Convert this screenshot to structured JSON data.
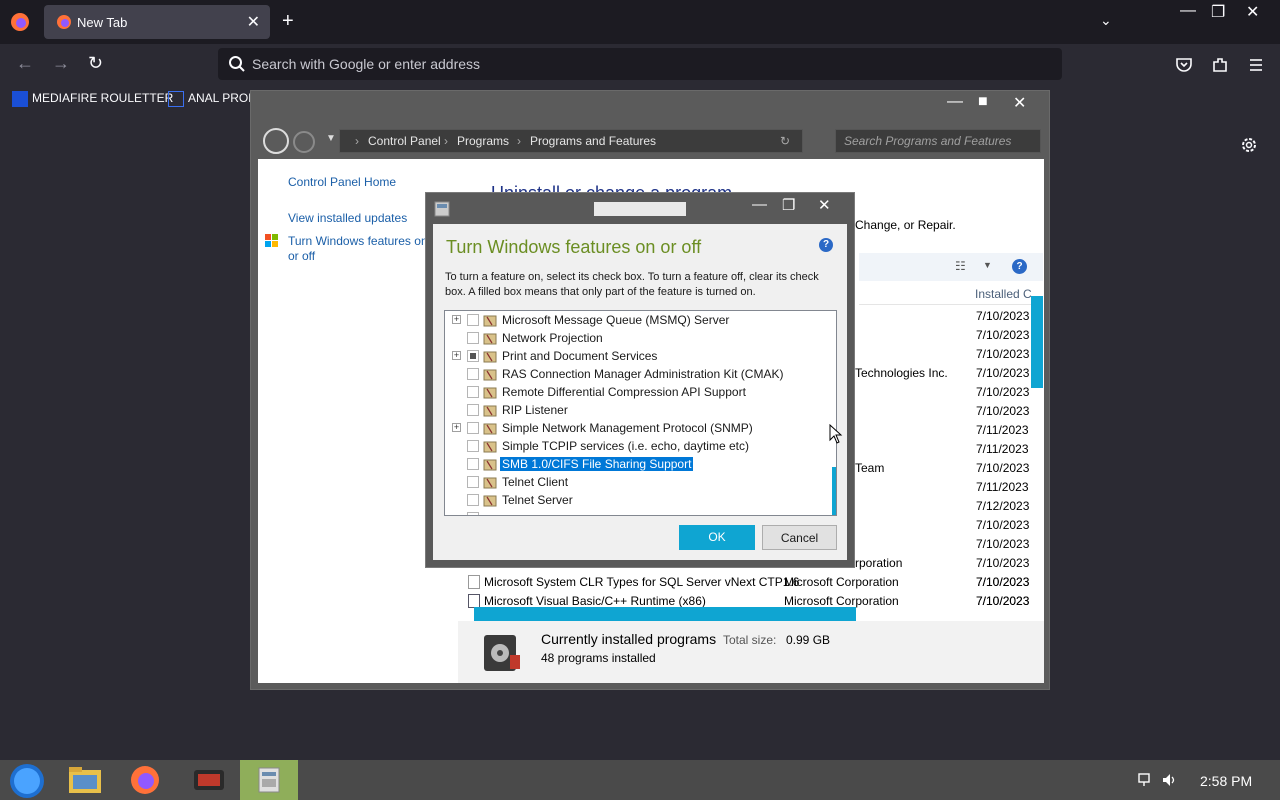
{
  "browser": {
    "tab_title": "New Tab",
    "url_placeholder": "Search with Google or enter address",
    "bookmarks": [
      {
        "label": "MEDIAFIRE ROULETTER"
      },
      {
        "label": "ANAL PROL"
      }
    ]
  },
  "control_panel": {
    "breadcrumb": [
      "Control Panel",
      "Programs",
      "Programs and Features"
    ],
    "search_placeholder": "Search Programs and Features",
    "sidebar": {
      "home": "Control Panel Home",
      "updates": "View installed updates",
      "features": "Turn Windows features on or off"
    },
    "title": "Uninstall or change a program",
    "subtitle": "Change, or Repair.",
    "column_installed": "Installed C",
    "dates": [
      "7/10/2023",
      "7/10/2023",
      "7/10/2023",
      "7/10/2023",
      "7/10/2023",
      "7/10/2023",
      "7/11/2023",
      "7/11/2023",
      "7/10/2023",
      "7/11/2023",
      "7/12/2023",
      "7/10/2023",
      "7/10/2023",
      "7/10/2023",
      "7/10/2023",
      "7/10/2023"
    ],
    "publisher_fragments": {
      "row4": "Technologies Inc.",
      "row9": "Team",
      "row14": "rporation"
    },
    "programs": [
      {
        "name": "Microsoft System CLR Types for SQL Server vNext CTP1.6",
        "publisher": "Microsoft Corporation",
        "date": "7/10/2023"
      },
      {
        "name": "Microsoft Visual Basic/C++ Runtime (x86)",
        "publisher": "Microsoft Corporation",
        "date": "7/10/2023"
      }
    ],
    "status": {
      "heading": "Currently installed programs",
      "total_label": "Total size:",
      "total_value": "0.99 GB",
      "count": "48 programs installed"
    }
  },
  "features_dialog": {
    "heading": "Turn Windows features on or off",
    "description": "To turn a feature on, select its check box. To turn a feature off, clear its check box. A filled box means that only part of the feature is turned on.",
    "items": [
      {
        "label": "Microsoft Message Queue (MSMQ) Server",
        "expandable": true,
        "state": "off"
      },
      {
        "label": "Network Projection",
        "expandable": false,
        "state": "off"
      },
      {
        "label": "Print and Document Services",
        "expandable": true,
        "state": "partial"
      },
      {
        "label": "RAS Connection Manager Administration Kit (CMAK)",
        "expandable": false,
        "state": "off"
      },
      {
        "label": "Remote Differential Compression API Support",
        "expandable": false,
        "state": "off"
      },
      {
        "label": "RIP Listener",
        "expandable": false,
        "state": "off"
      },
      {
        "label": "Simple Network Management Protocol (SNMP)",
        "expandable": true,
        "state": "off"
      },
      {
        "label": "Simple TCPIP services (i.e. echo, daytime etc)",
        "expandable": false,
        "state": "off"
      },
      {
        "label": "SMB 1.0/CIFS File Sharing Support",
        "expandable": false,
        "state": "off",
        "selected": true
      },
      {
        "label": "Telnet Client",
        "expandable": false,
        "state": "off"
      },
      {
        "label": "Telnet Server",
        "expandable": false,
        "state": "off"
      }
    ],
    "ok_label": "OK",
    "cancel_label": "Cancel"
  },
  "taskbar": {
    "clock": "2:58 PM"
  },
  "colors": {
    "accent": "#0fa5d2",
    "selection": "#0078d7",
    "heading_green": "#6b8e23"
  }
}
